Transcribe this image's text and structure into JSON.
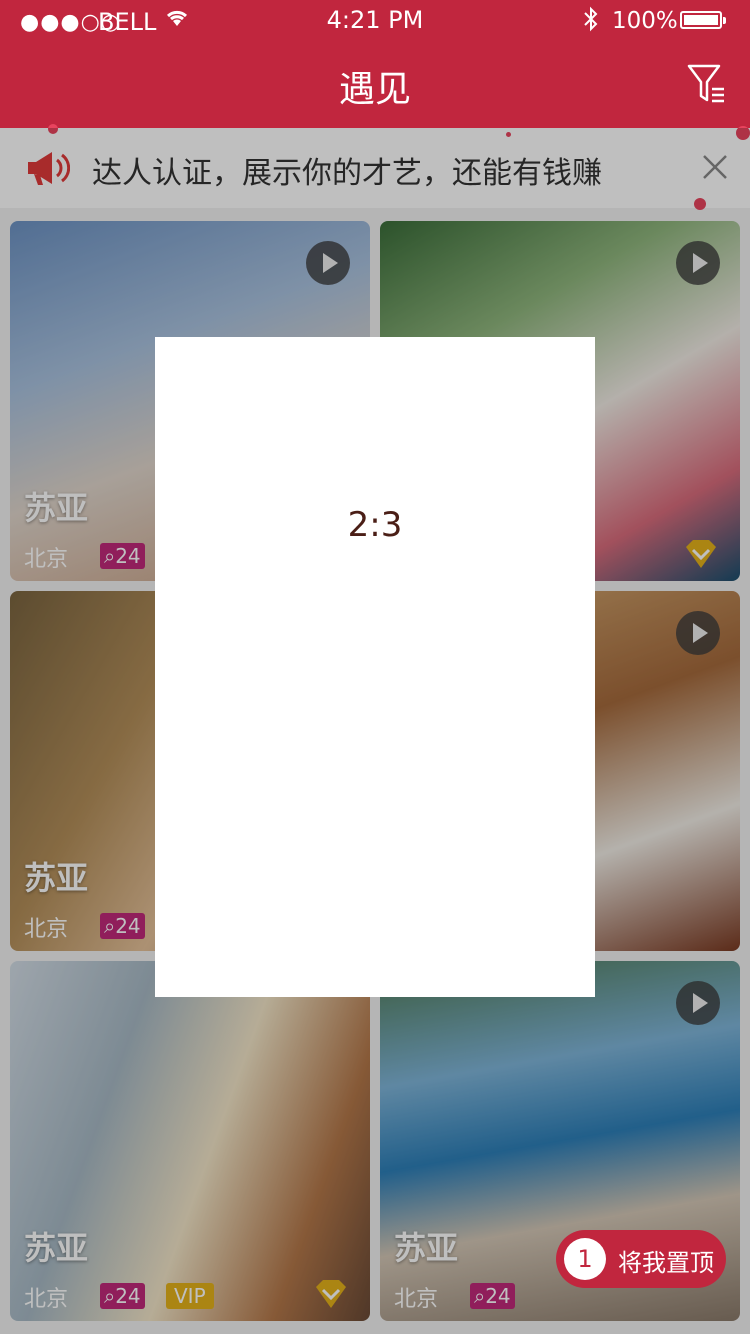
{
  "status_bar": {
    "signal": "●●●○○",
    "carrier": "BELL",
    "time": "4:21 PM",
    "battery_percent": "100%"
  },
  "nav": {
    "title": "遇见"
  },
  "notice": {
    "text": "达人认证，展示你的才艺，还能有钱赚"
  },
  "cards": [
    {
      "name": "苏亚",
      "city": "北京",
      "comments": "24",
      "vip": "",
      "has_play": true,
      "has_diamond": false
    },
    {
      "name": "",
      "city": "",
      "comments": "",
      "vip": "",
      "has_play": true,
      "has_diamond": true
    },
    {
      "name": "苏亚",
      "city": "北京",
      "comments": "24",
      "vip": "",
      "has_play": false,
      "has_diamond": false
    },
    {
      "name": "",
      "city": "",
      "comments": "",
      "vip": "",
      "has_play": true,
      "has_diamond": false
    },
    {
      "name": "苏亚",
      "city": "北京",
      "comments": "24",
      "vip": "VIP",
      "has_play": false,
      "has_diamond": true
    },
    {
      "name": "苏亚",
      "city": "北京",
      "comments": "24",
      "vip": "",
      "has_play": true,
      "has_diamond": false
    }
  ],
  "dialog": {
    "ratio": "2:3"
  },
  "pin_button": {
    "count": "1",
    "label": "将我置顶"
  },
  "colors": {
    "brand": "#c1263e",
    "comment_badge": "#c0287a",
    "vip_badge": "#e5b21a"
  }
}
